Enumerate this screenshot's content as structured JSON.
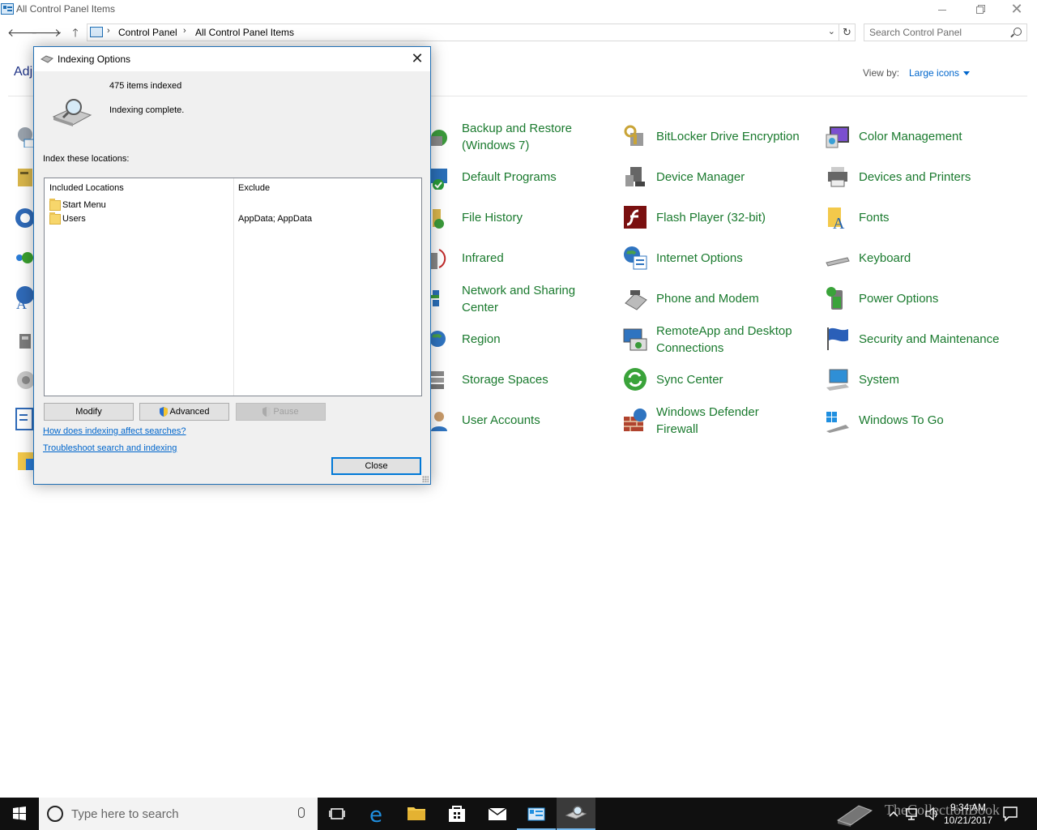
{
  "window": {
    "title": "All Control Panel Items"
  },
  "address": {
    "crumbs": [
      "Control Panel",
      "All Control Panel Items"
    ]
  },
  "search": {
    "placeholder": "Search Control Panel"
  },
  "header": {
    "adjust_partial": "Adj",
    "view_by_label": "View by:",
    "view_by_value": "Large icons"
  },
  "items": [
    {
      "label_line1": "Backup and Restore",
      "label_line2": "(Windows 7)",
      "icon": "backup-icon"
    },
    {
      "label": "BitLocker Drive Encryption",
      "icon": "bitlocker-icon"
    },
    {
      "label": "Color Management",
      "icon": "color-management-icon"
    },
    {
      "label": "Default Programs",
      "icon": "default-programs-icon"
    },
    {
      "label": "Device Manager",
      "icon": "device-manager-icon"
    },
    {
      "label": "Devices and Printers",
      "icon": "devices-printers-icon"
    },
    {
      "label": "File History",
      "icon": "file-history-icon"
    },
    {
      "label": "Flash Player (32-bit)",
      "icon": "flash-player-icon"
    },
    {
      "label": "Fonts",
      "icon": "fonts-icon"
    },
    {
      "label": "Infrared",
      "icon": "infrared-icon"
    },
    {
      "label": "Internet Options",
      "icon": "internet-options-icon"
    },
    {
      "label": "Keyboard",
      "icon": "keyboard-icon"
    },
    {
      "label_line1": "Network and Sharing",
      "label_line2": "Center",
      "icon": "network-icon"
    },
    {
      "label": "Phone and Modem",
      "icon": "phone-modem-icon"
    },
    {
      "label": "Power Options",
      "icon": "power-options-icon"
    },
    {
      "label": "Region",
      "icon": "region-icon"
    },
    {
      "label_line1": "RemoteApp and Desktop",
      "label_line2": "Connections",
      "icon": "remoteapp-icon"
    },
    {
      "label": "Security and Maintenance",
      "icon": "security-flag-icon"
    },
    {
      "label": "Storage Spaces",
      "icon": "storage-spaces-icon"
    },
    {
      "label": "Sync Center",
      "icon": "sync-center-icon"
    },
    {
      "label": "System",
      "icon": "system-icon"
    },
    {
      "label": "User Accounts",
      "icon": "user-accounts-icon"
    },
    {
      "label_line1": "Windows Defender",
      "label_line2": "Firewall",
      "icon": "firewall-icon"
    },
    {
      "label": "Windows To Go",
      "icon": "windows-to-go-icon"
    }
  ],
  "dialog": {
    "title": "Indexing Options",
    "items_indexed": "475 items indexed",
    "status": "Indexing complete.",
    "locations_label": "Index these locations:",
    "col_included": "Included Locations",
    "col_exclude": "Exclude",
    "rows": [
      {
        "name": "Start Menu",
        "exclude": ""
      },
      {
        "name": "Users",
        "exclude": "AppData; AppData"
      }
    ],
    "btn_modify": "Modify",
    "btn_advanced": "Advanced",
    "btn_pause": "Pause",
    "link_affect": "How does indexing affect searches?",
    "link_troubleshoot": "Troubleshoot search and indexing",
    "btn_close": "Close"
  },
  "taskbar": {
    "search_placeholder": "Type here to search",
    "time": "9:34 AM",
    "date": "10/21/2017"
  },
  "watermark": "TheCollectionBook",
  "colors": {
    "link_green": "#1a7a2e",
    "link_blue": "#0066cc",
    "accent": "#0078d7",
    "taskbar": "#101010"
  }
}
